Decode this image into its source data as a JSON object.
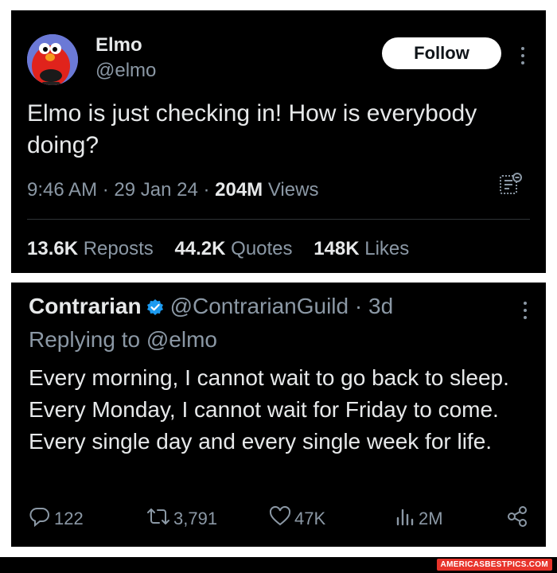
{
  "tweet1": {
    "author_name": "Elmo",
    "author_handle": "@elmo",
    "follow_label": "Follow",
    "text": "Elmo is just checking in! How is everybody doing?",
    "time": "9:46 AM",
    "date": "29 Jan 24",
    "sep": " · ",
    "views_count": "204M",
    "views_label": " Views",
    "reposts_count": "13.6K",
    "reposts_label": " Reposts",
    "quotes_count": "44.2K",
    "quotes_label": " Quotes",
    "likes_count": "148K",
    "likes_label": " Likes"
  },
  "tweet2": {
    "author_name": "Contrarian",
    "author_handle": "@ContrarianGuild",
    "age": " · 3d",
    "replying_to": "Replying to @elmo",
    "text": "Every morning, I cannot wait to go back to sleep. Every Monday, I cannot wait for Friday to come. Every single day and every single week for life.",
    "replies": "122",
    "retweets": "3,791",
    "likes": "47K",
    "views": "2M"
  },
  "watermark": "AMERICASBESTPICS.COM",
  "colors": {
    "background": "#000000",
    "text": "#e7e9ea",
    "muted": "#8b98a5",
    "verified_badge": "#1d9bf0",
    "watermark_bg": "#e8342b"
  },
  "icons": [
    "elmo-avatar",
    "kebab-icon",
    "analytics-icon",
    "verified-badge-icon",
    "reply-icon",
    "retweet-icon",
    "heart-icon",
    "views-icon",
    "share-icon"
  ]
}
